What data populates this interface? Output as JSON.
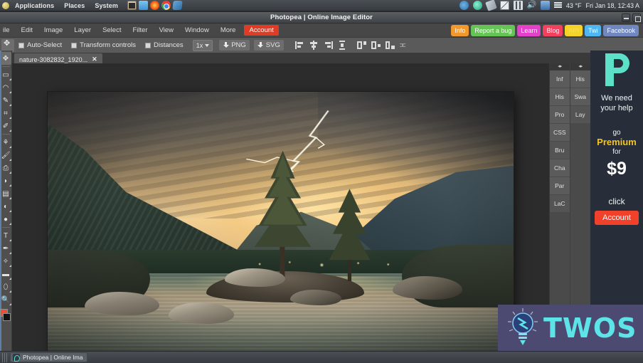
{
  "desktop": {
    "panel": {
      "menus": [
        "Applications",
        "Places",
        "System"
      ],
      "launchers": [
        "terminal-icon",
        "files-icon",
        "firefox-icon",
        "chrome-icon",
        "app-blue-icon"
      ],
      "tray": [
        "sync-icon",
        "dropbox-icon",
        "broom-icon",
        "mail-icon",
        "equalizer-icon",
        "volume-icon",
        "printer-icon"
      ],
      "weather": "43 °F",
      "clock": "Fri Jan 18, 12:43 A"
    },
    "taskbar": {
      "window_label": "Photopea | Online Ima"
    }
  },
  "window": {
    "title": "Photopea | Online Image Editor",
    "controls": [
      "minimize",
      "maximize"
    ]
  },
  "menubar": {
    "items": [
      "ile",
      "Edit",
      "Image",
      "Layer",
      "Select",
      "Filter",
      "View",
      "Window",
      "More"
    ],
    "account": "Account",
    "links": [
      {
        "label": "Info",
        "color": "#f2992e"
      },
      {
        "label": "Report a bug",
        "color": "#66c457"
      },
      {
        "label": "Learn",
        "color": "#e341c9"
      },
      {
        "label": "Blog",
        "color": "#f2415f"
      },
      {
        "label": "API",
        "color": "#f5d327"
      },
      {
        "label": "Twi",
        "color": "#4fb6f0"
      },
      {
        "label": "Facebook",
        "color": "#7087c0"
      }
    ]
  },
  "options_bar": {
    "tool_icon": "move-tool-icon",
    "checkboxes": [
      {
        "label": "Auto-Select",
        "checked": true
      },
      {
        "label": "Transform controls",
        "checked": true
      },
      {
        "label": "Distances",
        "checked": true
      }
    ],
    "zoom": "1x",
    "downloads": [
      {
        "label": "PNG",
        "icon": "download-icon"
      },
      {
        "label": "SVG",
        "icon": "download-icon"
      }
    ],
    "align_icons": [
      "align-left-icon",
      "align-center-h-icon",
      "align-right-icon",
      "distribute-icon"
    ],
    "arrange_icons": [
      "arrange-top-icon",
      "arrange-middle-icon",
      "arrange-bottom-icon",
      "text-spacing-icon"
    ]
  },
  "tabs": [
    {
      "title": "nature-3082832_1920...",
      "close": "✕",
      "active": true
    }
  ],
  "toolbox": {
    "tools": [
      "move-tool",
      "marquee-tool",
      "lasso-tool",
      "magic-wand-tool",
      "crop-tool",
      "eyedropper-tool",
      "healing-brush-tool",
      "brush-tool",
      "stamp-tool",
      "eraser-tool",
      "gradient-tool",
      "blur-tool",
      "dodge-tool",
      "type-tool",
      "pen-tool",
      "shape-tool",
      "rectangle-tool",
      "paint-bucket-tool",
      "zoom-tool"
    ],
    "foreground_color": "#f04e32",
    "background_color": "#121212"
  },
  "panels": {
    "left_column": [
      "Inf",
      "His",
      "Pro",
      "CSS",
      "Bru",
      "Cha",
      "Par",
      "LaC"
    ],
    "right_column": [
      "His",
      "Swa",
      "Lay"
    ],
    "collapse_glyph": "◂▸"
  },
  "ad_panel": {
    "logo": "photopea-logo",
    "headline_line1": "We need",
    "headline_line2": "your help",
    "go": "go",
    "premium": "Premium",
    "for": "for",
    "price": "$9",
    "click": "click",
    "account_button": "Account"
  },
  "watermark": {
    "icon": "lightbulb-icon",
    "text": "TWOS"
  },
  "canvas": {
    "document_name": "nature-3082832_1920",
    "description": "mountain lake landscape with lightning storm"
  }
}
